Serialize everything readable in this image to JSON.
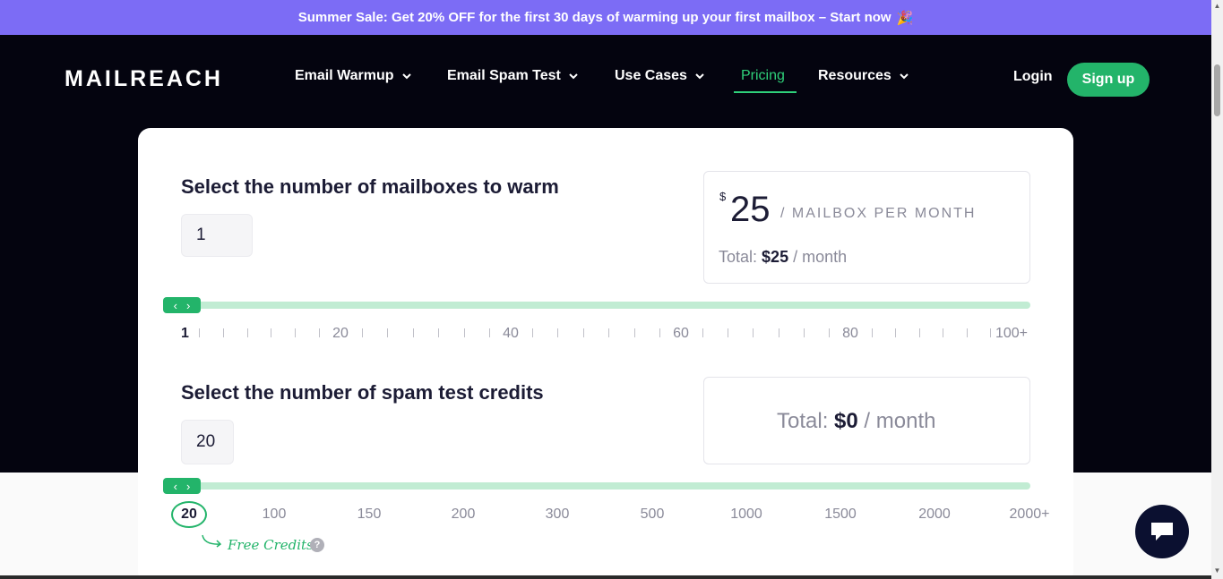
{
  "promo": {
    "text": "Summer Sale: Get 20% OFF for the first 30 days of warming up your first mailbox – Start now",
    "emoji": "🎉"
  },
  "nav": {
    "logo": "MAILREACH",
    "items": [
      {
        "label": "Email Warmup"
      },
      {
        "label": "Email Spam Test"
      },
      {
        "label": "Use Cases"
      },
      {
        "label": "Pricing"
      },
      {
        "label": "Resources"
      }
    ],
    "login": "Login",
    "signup": "Sign up"
  },
  "mailboxes": {
    "title": "Select the number of mailboxes to warm",
    "value": "1",
    "currency": "$",
    "price": "25",
    "unit": "/ MAILBOX PER MONTH",
    "total_label": "Total:",
    "total_value": "$25",
    "total_suffix": "/ month",
    "labels": [
      "1",
      "20",
      "40",
      "60",
      "80",
      "100+"
    ],
    "fraction": 0
  },
  "spam": {
    "title": "Select the number of spam test credits",
    "value": "20",
    "total_label": "Total:",
    "total_value": "$0",
    "total_suffix": "/ month",
    "labels": [
      "20",
      "100",
      "150",
      "200",
      "300",
      "500",
      "1000",
      "1500",
      "2000",
      "2000+"
    ],
    "free_credits": "Free Credits",
    "help": "?",
    "fraction": 0
  },
  "colors": {
    "accent": "#23b46a",
    "promo": "#7c6cf5",
    "nav": "#04040f",
    "track": "#c1ecd3"
  },
  "icons": {
    "chat": "chat-bubble-icon",
    "thumb": "chevron-left-right-icon"
  }
}
